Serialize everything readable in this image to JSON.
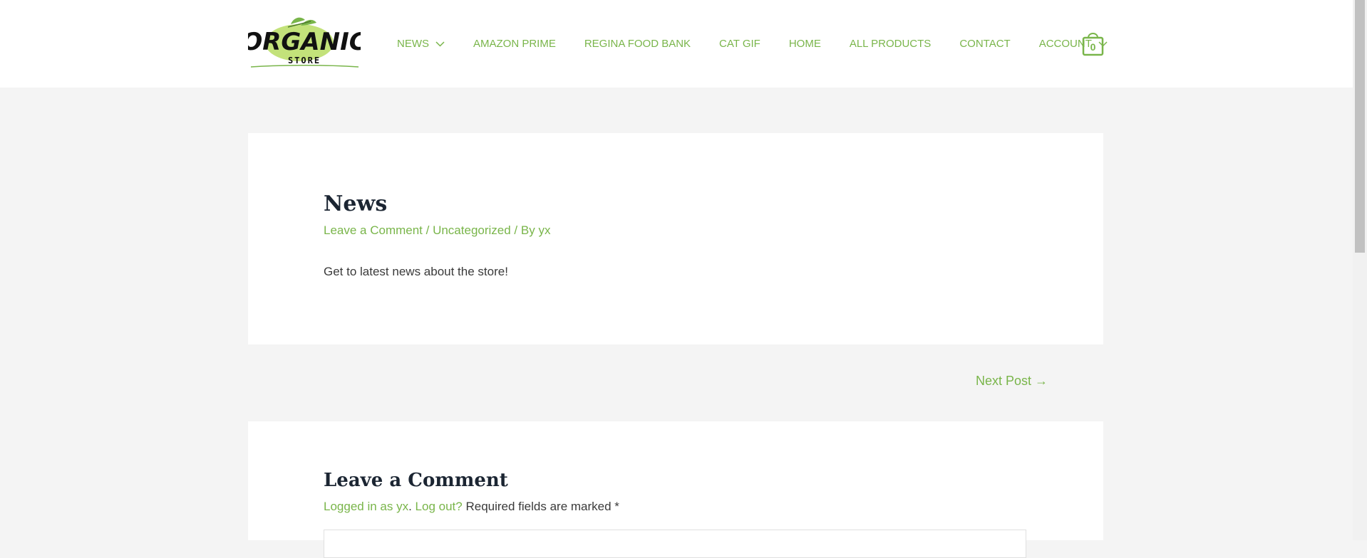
{
  "colors": {
    "accent": "#79b54a",
    "heading": "#1b2532",
    "text": "#3a3a3a",
    "page_bg": "#f4f4f4"
  },
  "logo": {
    "main": "ORGANIC",
    "sub": "STORE"
  },
  "nav": {
    "items": [
      {
        "label": "NEWS",
        "has_dropdown": true
      },
      {
        "label": "AMAZON PRIME"
      },
      {
        "label": "REGINA FOOD BANK"
      },
      {
        "label": "CAT GIF"
      },
      {
        "label": "HOME"
      },
      {
        "label": "ALL PRODUCTS"
      },
      {
        "label": "CONTACT"
      },
      {
        "label": "ACCOUNT",
        "has_dropdown": true
      }
    ],
    "cart_count": "0",
    "dropdown_icon": "chevron-down-icon",
    "cart_icon": "shopping-bag-icon"
  },
  "post": {
    "title": "News",
    "meta": {
      "comment_link": "Leave a Comment",
      "sep1": " / ",
      "category": "Uncategorized",
      "sep2": " / By ",
      "author": "yx"
    },
    "excerpt": "Get to latest news about the store!"
  },
  "navigation": {
    "next_label": "Next Post →"
  },
  "comments": {
    "title": "Leave a Comment",
    "logged_in_link": "Logged in as yx",
    "sep": ". ",
    "logout_link": "Log out?",
    "required_text": " Required fields are marked *"
  }
}
